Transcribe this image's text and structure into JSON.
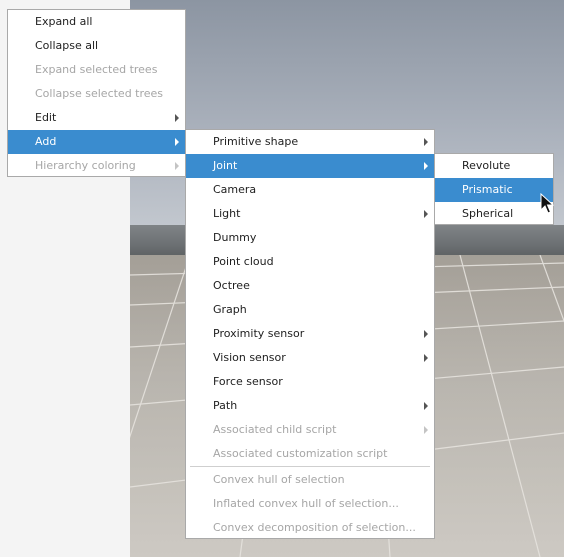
{
  "main_menu": {
    "items": [
      {
        "label": "Expand all",
        "enabled": true
      },
      {
        "label": "Collapse all",
        "enabled": true
      },
      {
        "label": "Expand selected trees",
        "enabled": false
      },
      {
        "label": "Collapse selected trees",
        "enabled": false
      },
      {
        "label": "Edit",
        "enabled": true,
        "submenu": true
      },
      {
        "label": "Add",
        "enabled": true,
        "submenu": true,
        "selected": true
      },
      {
        "label": "Hierarchy coloring",
        "enabled": false,
        "submenu": true
      }
    ]
  },
  "add_menu": {
    "items": [
      {
        "label": "Primitive shape",
        "enabled": true,
        "submenu": true
      },
      {
        "label": "Joint",
        "enabled": true,
        "submenu": true,
        "selected": true
      },
      {
        "label": "Camera",
        "enabled": true
      },
      {
        "label": "Light",
        "enabled": true,
        "submenu": true
      },
      {
        "label": "Dummy",
        "enabled": true
      },
      {
        "label": "Point cloud",
        "enabled": true
      },
      {
        "label": "Octree",
        "enabled": true
      },
      {
        "label": "Graph",
        "enabled": true
      },
      {
        "label": "Proximity sensor",
        "enabled": true,
        "submenu": true
      },
      {
        "label": "Vision sensor",
        "enabled": true,
        "submenu": true
      },
      {
        "label": "Force sensor",
        "enabled": true
      },
      {
        "label": "Path",
        "enabled": true,
        "submenu": true
      },
      {
        "label": "Associated child script",
        "enabled": false,
        "submenu": true
      },
      {
        "label": "Associated customization script",
        "enabled": false
      },
      {
        "label": "Convex hull of selection",
        "enabled": false
      },
      {
        "label": "Inflated convex hull of selection...",
        "enabled": false
      },
      {
        "label": "Convex decomposition of selection...",
        "enabled": false
      }
    ]
  },
  "joint_menu": {
    "items": [
      {
        "label": "Revolute",
        "enabled": true
      },
      {
        "label": "Prismatic",
        "enabled": true,
        "selected": true
      },
      {
        "label": "Spherical",
        "enabled": true
      }
    ]
  },
  "colors": {
    "highlight": "#3a8ccf",
    "disabled_text": "#a6a6a6"
  }
}
